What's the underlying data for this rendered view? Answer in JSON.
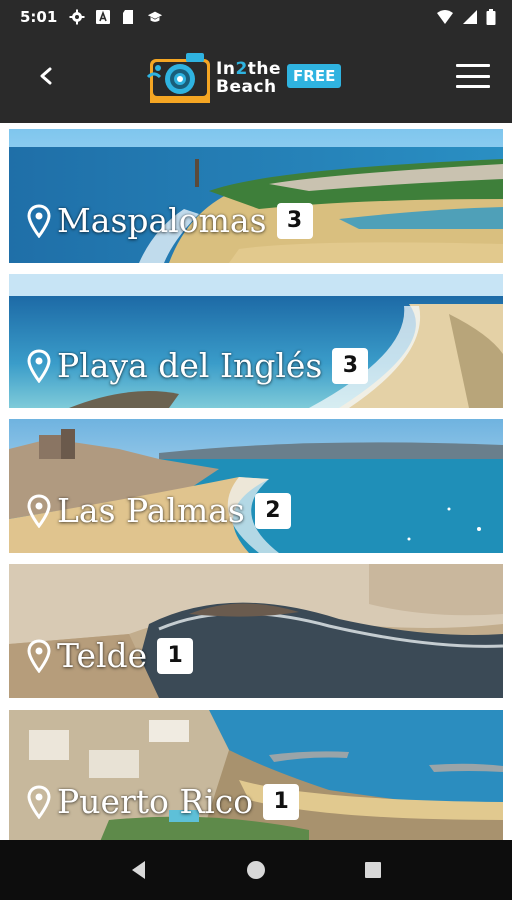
{
  "status_bar": {
    "time": "5:01",
    "left_icons": [
      "gear-icon",
      "font-icon",
      "sd-card-icon",
      "graduation-cap-icon"
    ],
    "right_icons": [
      "wifi-icon",
      "cellular-signal-icon",
      "battery-icon"
    ]
  },
  "header": {
    "logo_line1_prefix": "In",
    "logo_line1_number": "2",
    "logo_line1_suffix": "the",
    "logo_line2": "Beach",
    "badge": "FREE",
    "back_icon": "back-arrow-icon",
    "menu_icon": "hamburger-menu-icon"
  },
  "locations": [
    {
      "name": "Maspalomas",
      "count": "3"
    },
    {
      "name": "Playa del Inglés",
      "count": "3"
    },
    {
      "name": "Las Palmas",
      "count": "2"
    },
    {
      "name": "Telde",
      "count": "1"
    },
    {
      "name": "Puerto Rico",
      "count": "1"
    }
  ],
  "nav_bar": {
    "buttons": [
      "back-triangle-icon",
      "home-circle-icon",
      "recents-square-icon"
    ]
  },
  "colors": {
    "accent": "#2fb3e0",
    "header_bg": "#2a2a2a",
    "nav_bg": "#0d0d0d"
  }
}
